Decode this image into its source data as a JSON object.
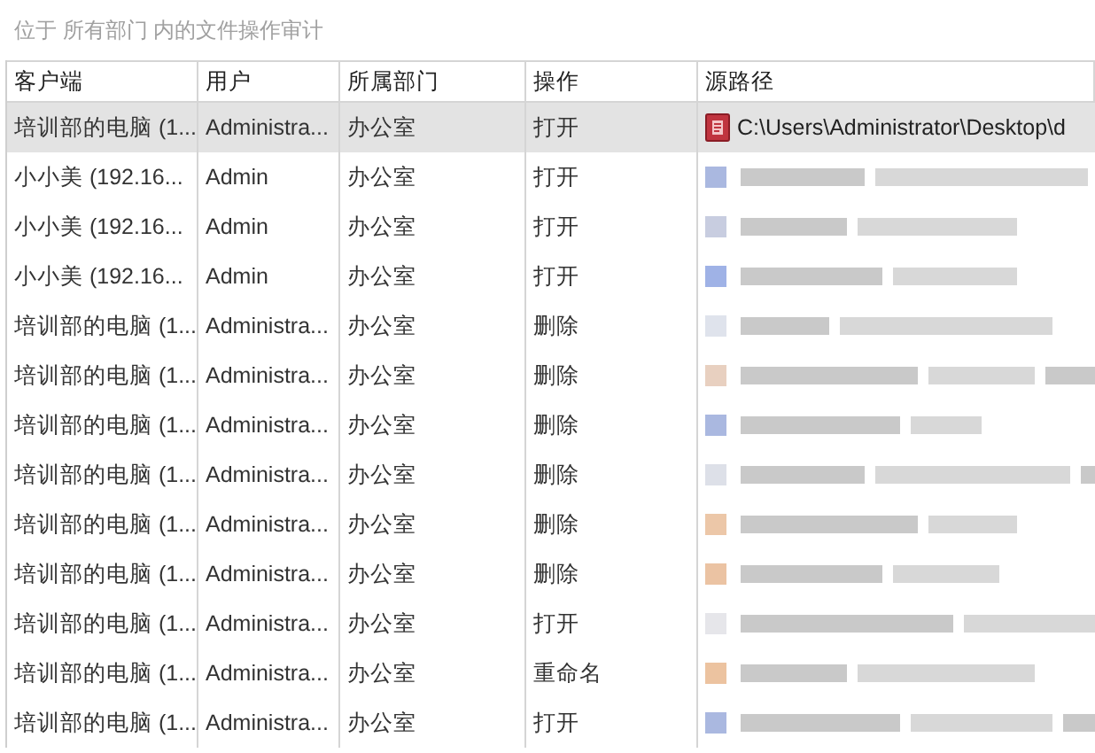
{
  "title": "位于 所有部门 内的文件操作审计",
  "table": {
    "columns": [
      "客户端",
      "用户",
      "所属部门",
      "操作",
      "源路径"
    ],
    "rows": [
      {
        "selected": true,
        "client": "培训部的电脑 (1...",
        "user": "Administra...",
        "department": "办公室",
        "action": "打开",
        "source_path": "C:\\Users\\Administrator\\Desktop\\d"
      },
      {
        "selected": false,
        "client": "小小美 (192.16...",
        "user": "Admin",
        "department": "办公室",
        "action": "打开"
      },
      {
        "selected": false,
        "client": "小小美 (192.16...",
        "user": "Admin",
        "department": "办公室",
        "action": "打开"
      },
      {
        "selected": false,
        "client": "小小美 (192.16...",
        "user": "Admin",
        "department": "办公室",
        "action": "打开"
      },
      {
        "selected": false,
        "client": "培训部的电脑 (1...",
        "user": "Administra...",
        "department": "办公室",
        "action": "删除"
      },
      {
        "selected": false,
        "client": "培训部的电脑 (1...",
        "user": "Administra...",
        "department": "办公室",
        "action": "删除"
      },
      {
        "selected": false,
        "client": "培训部的电脑 (1...",
        "user": "Administra...",
        "department": "办公室",
        "action": "删除"
      },
      {
        "selected": false,
        "client": "培训部的电脑 (1...",
        "user": "Administra...",
        "department": "办公室",
        "action": "删除"
      },
      {
        "selected": false,
        "client": "培训部的电脑 (1...",
        "user": "Administra...",
        "department": "办公室",
        "action": "删除"
      },
      {
        "selected": false,
        "client": "培训部的电脑 (1...",
        "user": "Administra...",
        "department": "办公室",
        "action": "删除"
      },
      {
        "selected": false,
        "client": "培训部的电脑 (1...",
        "user": "Administra...",
        "department": "办公室",
        "action": "打开"
      },
      {
        "selected": false,
        "client": "培训部的电脑 (1...",
        "user": "Administra...",
        "department": "办公室",
        "action": "重命名"
      },
      {
        "selected": false,
        "client": "培训部的电脑 (1...",
        "user": "Administra...",
        "department": "办公室",
        "action": "打开"
      }
    ]
  }
}
